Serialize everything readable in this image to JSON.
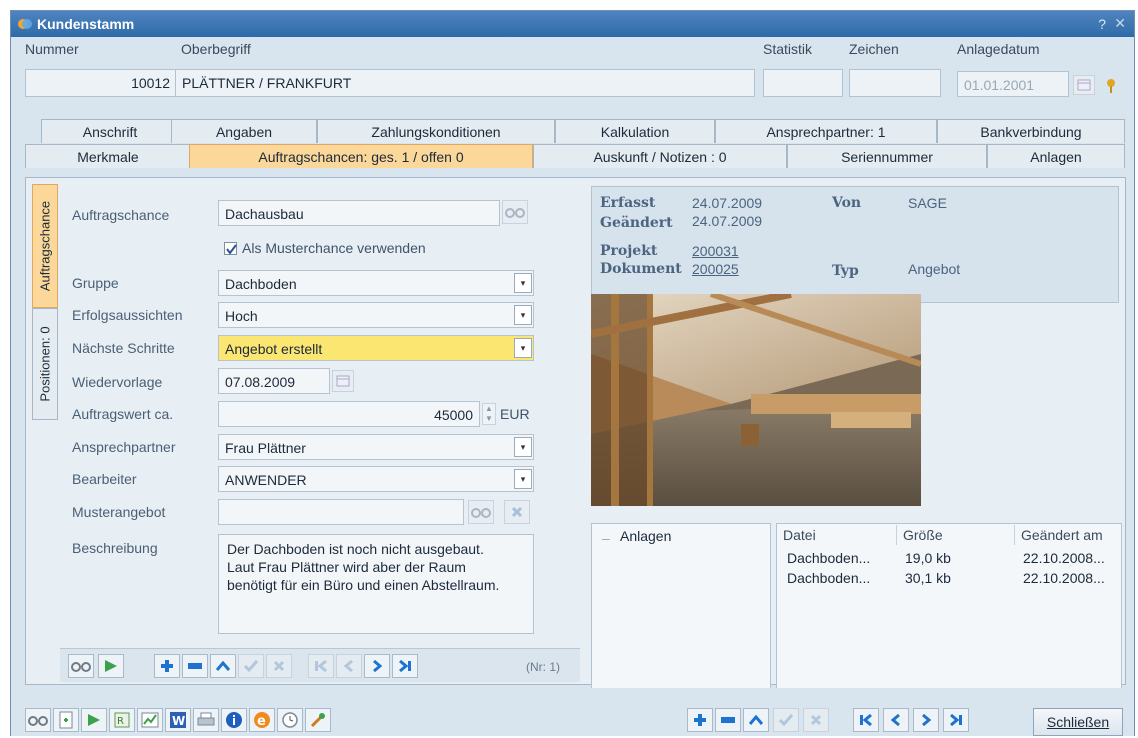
{
  "window": {
    "title": "Kundenstamm",
    "help": "?",
    "close": "✕"
  },
  "header": {
    "nummer_label": "Nummer",
    "nummer_value": "10012",
    "oberbegriff_label": "Oberbegriff",
    "oberbegriff_value": "PLÄTTNER / FRANKFURT",
    "statistik_label": "Statistik",
    "zeichen_label": "Zeichen",
    "anlagedatum_label": "Anlagedatum",
    "anlagedatum_value": "01.01.2001"
  },
  "tabs_row1": [
    "Anschrift",
    "Angaben",
    "Zahlungskonditionen",
    "Kalkulation",
    "Ansprechpartner: 1",
    "Bankverbindung"
  ],
  "tabs_row2": [
    "Merkmale",
    "Auftragschancen: ges. 1 / offen 0",
    "Auskunft / Notizen : 0",
    "Seriennummer",
    "Anlagen"
  ],
  "side_tabs": [
    "Auftragschance",
    "Positionen: 0"
  ],
  "form": {
    "auftragschance_label": "Auftragschance",
    "auftragschance_value": "Dachausbau",
    "musterchance_label": "Als Musterchance verwenden",
    "musterchance_checked": true,
    "gruppe_label": "Gruppe",
    "gruppe_value": "Dachboden",
    "erfolg_label": "Erfolgsaussichten",
    "erfolg_value": "Hoch",
    "schritte_label": "Nächste Schritte",
    "schritte_value": "Angebot erstellt",
    "wiedervorlage_label": "Wiedervorlage",
    "wiedervorlage_value": "07.08.2009",
    "auftragswert_label": "Auftragswert ca.",
    "auftragswert_value": "45000",
    "currency": "EUR",
    "ansprechpartner_label": "Ansprechpartner",
    "ansprechpartner_value": "Frau Plättner",
    "bearbeiter_label": "Bearbeiter",
    "bearbeiter_value": "ANWENDER",
    "musterangebot_label": "Musterangebot",
    "beschreibung_label": "Beschreibung",
    "beschreibung_value": "Der Dachboden ist noch nicht ausgebaut. Laut Frau Plättner wird aber der Raum benötigt für ein Büro und einen Abstellraum."
  },
  "record_counter": "(Nr: 1)",
  "info": {
    "erfasst_label": "Erfasst",
    "erfasst_value": "24.07.2009",
    "geaendert_label": "Geändert",
    "geaendert_value": "24.07.2009",
    "von_label": "Von",
    "von_value": "SAGE",
    "projekt_label": "Projekt",
    "projekt_value": "200031",
    "dokument_label": "Dokument",
    "dokument_value": "200025",
    "typ_label": "Typ",
    "typ_value": "Angebot"
  },
  "attachments": {
    "tree_root": "Anlagen",
    "columns": [
      "Datei",
      "Größe",
      "Geändert am"
    ],
    "rows": [
      [
        "Dachboden...",
        "19,0 kb",
        "22.10.2008..."
      ],
      [
        "Dachboden...",
        "30,1 kb",
        "22.10.2008..."
      ]
    ]
  },
  "close_button": "Schließen",
  "colors": {
    "accent_tab": "#fbd79a",
    "highlight_field": "#fbe672",
    "title_bar": "#3a75b4"
  }
}
